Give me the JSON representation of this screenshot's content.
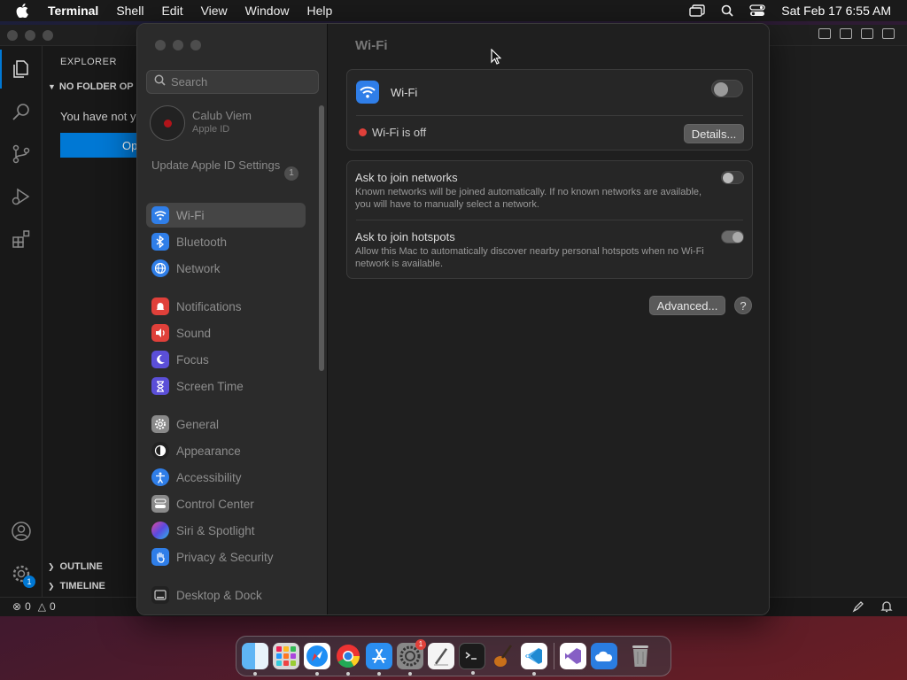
{
  "menubar": {
    "app_name": "Terminal",
    "items": [
      "Shell",
      "Edit",
      "View",
      "Window",
      "Help"
    ],
    "clock": "Sat Feb 17  6:55 AM"
  },
  "vscode": {
    "explorer_header": "EXPLORER",
    "no_folder": "NO FOLDER OP",
    "message": "You have not y",
    "open_button": "Op",
    "outline": "OUTLINE",
    "timeline": "TIMELINE",
    "errors": "0",
    "warnings": "0",
    "settings_badge": "1"
  },
  "settings": {
    "search_placeholder": "Search",
    "account": {
      "name": "Calub Viem",
      "subtitle": "Apple ID"
    },
    "update": {
      "label": "Update Apple ID Settings",
      "badge": "1"
    },
    "sidebar_items": [
      {
        "label": "Wi-Fi",
        "icon": "wifi-icon",
        "color": "#2f7ee8",
        "selected": true
      },
      {
        "label": "Bluetooth",
        "icon": "bluetooth-icon",
        "color": "#2f7ee8"
      },
      {
        "label": "Network",
        "icon": "network-icon",
        "color": "#2f7ee8"
      },
      {
        "label": "Notifications",
        "icon": "notifications-icon",
        "color": "#e0403a"
      },
      {
        "label": "Sound",
        "icon": "sound-icon",
        "color": "#e0403a"
      },
      {
        "label": "Focus",
        "icon": "focus-icon",
        "color": "#5b4fd8"
      },
      {
        "label": "Screen Time",
        "icon": "screen-time-icon",
        "color": "#5b4fd8"
      },
      {
        "label": "General",
        "icon": "general-icon",
        "color": "#8a8a8a"
      },
      {
        "label": "Appearance",
        "icon": "appearance-icon",
        "color": "#222222"
      },
      {
        "label": "Accessibility",
        "icon": "accessibility-icon",
        "color": "#2f7ee8"
      },
      {
        "label": "Control Center",
        "icon": "control-center-icon",
        "color": "#8a8a8a"
      },
      {
        "label": "Siri & Spotlight",
        "icon": "siri-icon",
        "color": "#b04ad0"
      },
      {
        "label": "Privacy & Security",
        "icon": "privacy-hand-icon",
        "color": "#2f7ee8"
      },
      {
        "label": "Desktop & Dock",
        "icon": "desktop-dock-icon",
        "color": "#222222"
      }
    ],
    "content": {
      "title": "Wi-Fi",
      "wifi_label": "Wi-Fi",
      "status": "Wi-Fi is off",
      "status_color": "#e0403a",
      "details_button": "Details...",
      "ask_networks": {
        "title": "Ask to join networks",
        "desc": "Known networks will be joined automatically. If no known networks are available, you will have to manually select a network."
      },
      "ask_hotspots": {
        "title": "Ask to join hotspots",
        "desc": "Allow this Mac to automatically discover nearby personal hotspots when no Wi-Fi network is available."
      },
      "advanced_button": "Advanced...",
      "help_button": "?"
    }
  },
  "dock": {
    "apps": [
      "finder",
      "launchpad",
      "safari",
      "chrome",
      "app-store",
      "system-settings",
      "textedit",
      "terminal",
      "instruments",
      "vscode",
      "visual-studio",
      "onedrive",
      "trash"
    ],
    "settings_badge": "1"
  }
}
